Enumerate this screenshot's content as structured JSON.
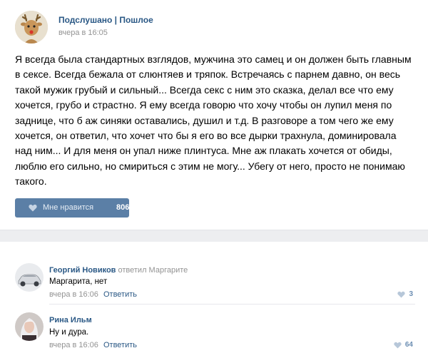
{
  "post": {
    "author": "Подслушано | Пошлое",
    "time": "вчера в 16:05",
    "text": "Я всегда была стандартных взглядов, мужчина это самец и он должен быть главным в сексе. Всегда бежала от слюнтяев и тряпок. Встречаясь с парнем давно, он весь такой мужик грубый и сильный... Всегда секс с ним это сказка, делал все что ему хочется, грубо и страстно. Я ему всегда говорю что хочу чтобы он лупил меня по заднице, что б аж синяки оставались, душил и т.д. В разговоре а том чего же ему хочется, он ответил, что хочет что бы я его во все дырки трахнула, доминировала над ним... И для меня он упал ниже плинтуса. Мне аж плакать хочется от обиды, люблю его сильно, но смириться с этим не могу... Убегу от него, просто не понимаю такого.",
    "like_label": "Мне нравится",
    "like_count": "806"
  },
  "comments": [
    {
      "name": "Георгий Новиков",
      "replied": "ответил Маргарите",
      "text": "Маргарита, нет",
      "time": "вчера в 16:06",
      "reply_label": "Ответить",
      "likes": "3",
      "avatar_icon": "car-avatar-icon"
    },
    {
      "name": "Рина Ильм",
      "replied": "",
      "text": "Ну и дура.",
      "time": "вчера в 16:06",
      "reply_label": "Ответить",
      "likes": "64",
      "avatar_icon": "woman-avatar-icon"
    }
  ],
  "colors": {
    "link": "#2a5885",
    "like_button": "#5b7fa6",
    "meta": "#939393",
    "separator": "#edeef0"
  }
}
